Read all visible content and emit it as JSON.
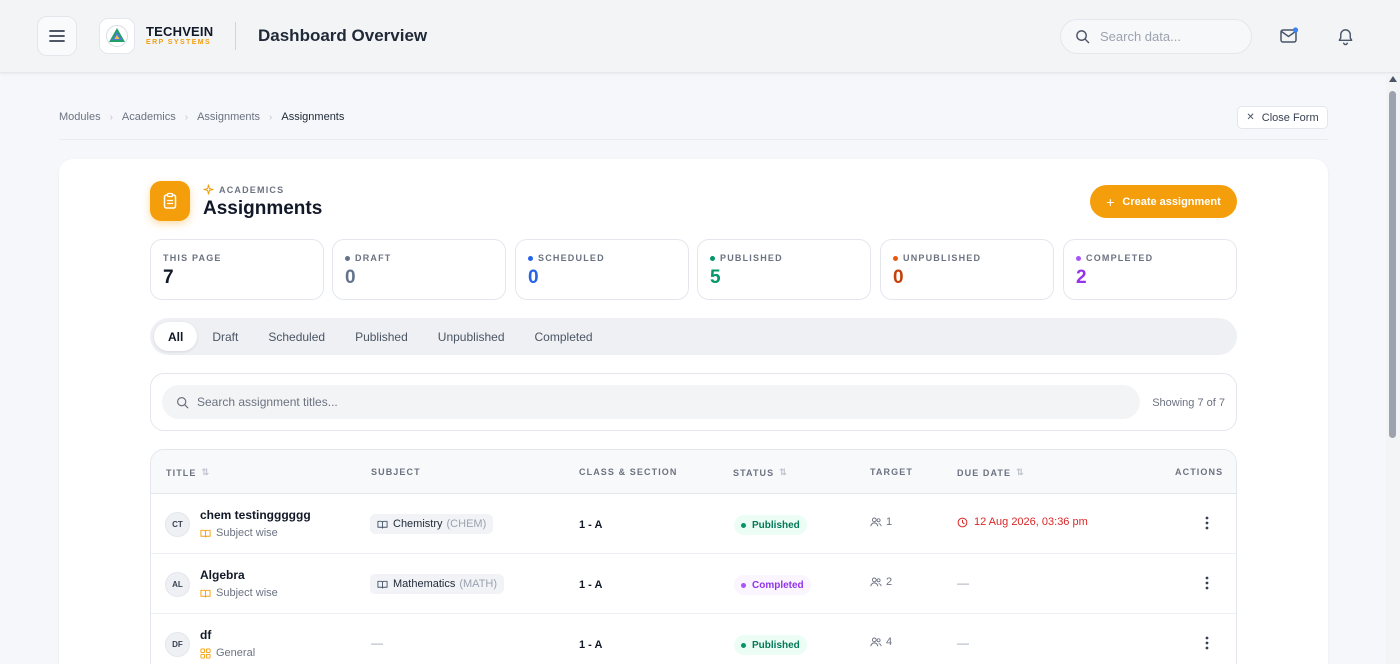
{
  "header": {
    "brand_name": "TECHVEIN",
    "brand_sub": "ERP SYSTEMS",
    "page_title": "Dashboard Overview",
    "search_placeholder": "Search data..."
  },
  "breadcrumb": [
    "Modules",
    "Academics",
    "Assignments",
    "Assignments"
  ],
  "close_form_label": "Close Form",
  "module": {
    "eyebrow": "ACADEMICS",
    "title": "Assignments",
    "create_label": "Create assignment"
  },
  "stats": [
    {
      "label": "THIS PAGE",
      "value": "7",
      "color": "#111827",
      "dot": ""
    },
    {
      "label": "DRAFT",
      "value": "0",
      "color": "#64748b",
      "dot": "#64748b"
    },
    {
      "label": "SCHEDULED",
      "value": "0",
      "color": "#2563eb",
      "dot": "#2563eb"
    },
    {
      "label": "PUBLISHED",
      "value": "5",
      "color": "#059669",
      "dot": "#059669"
    },
    {
      "label": "UNPUBLISHED",
      "value": "0",
      "color": "#c2410c",
      "dot": "#ea580c"
    },
    {
      "label": "COMPLETED",
      "value": "2",
      "color": "#9333ea",
      "dot": "#a855f7"
    }
  ],
  "tabs": [
    {
      "label": "All",
      "active": true
    },
    {
      "label": "Draft",
      "active": false
    },
    {
      "label": "Scheduled",
      "active": false
    },
    {
      "label": "Published",
      "active": false
    },
    {
      "label": "Unpublished",
      "active": false
    },
    {
      "label": "Completed",
      "active": false
    }
  ],
  "table_search": {
    "placeholder": "Search assignment titles...",
    "showing": "Showing 7 of 7"
  },
  "table": {
    "columns": {
      "title": "TITLE",
      "subject": "SUBJECT",
      "class_section": "CLASS & SECTION",
      "status": "STATUS",
      "target": "TARGET",
      "due_date": "DUE DATE",
      "actions": "ACTIONS"
    },
    "rows": [
      {
        "initials": "CT",
        "title": "chem testingggggg",
        "type": "Subject wise",
        "type_icon": "book-icon",
        "subject": "Chemistry",
        "subject_code": "(CHEM)",
        "class_section": "1 - A",
        "status": "Published",
        "target": "1",
        "due": "12 Aug 2026, 03:36 pm"
      },
      {
        "initials": "AL",
        "title": "Algebra",
        "type": "Subject wise",
        "type_icon": "book-icon",
        "subject": "Mathematics",
        "subject_code": "(MATH)",
        "class_section": "1 - A",
        "status": "Completed",
        "target": "2",
        "due": "—"
      },
      {
        "initials": "DF",
        "title": "df",
        "type": "General",
        "type_icon": "grid-icon",
        "subject": "",
        "subject_code": "",
        "subject_empty": "—",
        "class_section": "1 - A",
        "status": "Published",
        "target": "4",
        "due": "—"
      }
    ]
  },
  "colors": {
    "accent": "#f59e0b",
    "published": "#059669",
    "completed": "#a855f7",
    "due_alert": "#dc2626"
  }
}
